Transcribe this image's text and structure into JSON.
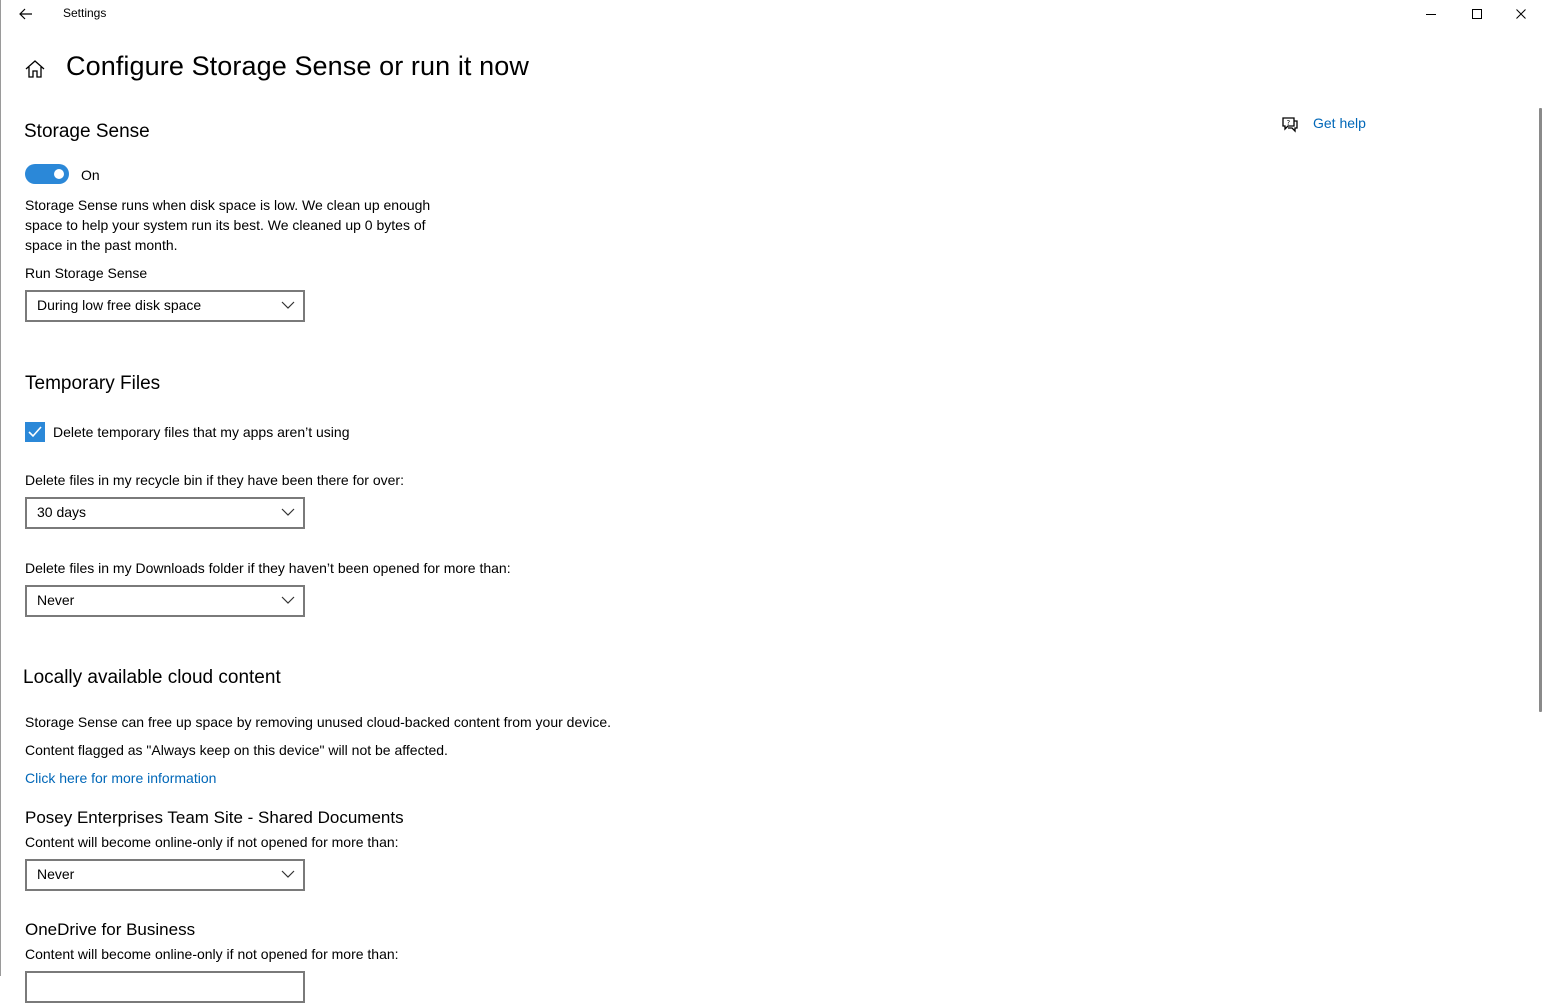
{
  "window": {
    "title": "Settings",
    "controls": {
      "minimize": "minimize-icon",
      "maximize": "maximize-icon",
      "close": "close-icon"
    }
  },
  "header": {
    "title": "Configure Storage Sense or run it now"
  },
  "help": {
    "label": "Get help"
  },
  "storage_sense": {
    "title": "Storage Sense",
    "toggle_state": "On",
    "description_line1": "Storage Sense runs when disk space is low. We clean up enough",
    "description_line2": "space to help your system run its best. We cleaned up 0 bytes of",
    "description_line3": "space in the past month.",
    "run_label": "Run Storage Sense",
    "run_value": "During low free disk space"
  },
  "temporary_files": {
    "title": "Temporary Files",
    "checkbox_label": "Delete temporary files that my apps aren’t using",
    "recycle_label": "Delete files in my recycle bin if they have been there for over:",
    "recycle_value": "30 days",
    "downloads_label": "Delete files in my Downloads folder if they haven’t been opened for more than:",
    "downloads_value": "Never"
  },
  "cloud_content": {
    "title": "Locally available cloud content",
    "description_line1": "Storage Sense can free up space by removing unused cloud-backed content from your device.",
    "description_line2": "Content flagged as \"Always keep on this device\" will not be affected.",
    "more_info_link": "Click here for more information",
    "locations": [
      {
        "name": "Posey Enterprises Team Site - Shared Documents",
        "label": "Content will become online-only if not opened for more than:",
        "value": "Never"
      },
      {
        "name": "OneDrive for Business",
        "label": "Content will become online-only if not opened for more than:",
        "value": ""
      }
    ]
  },
  "colors": {
    "accent": "#2b88d8",
    "link": "#0067b8",
    "border": "#7a7a7a"
  }
}
